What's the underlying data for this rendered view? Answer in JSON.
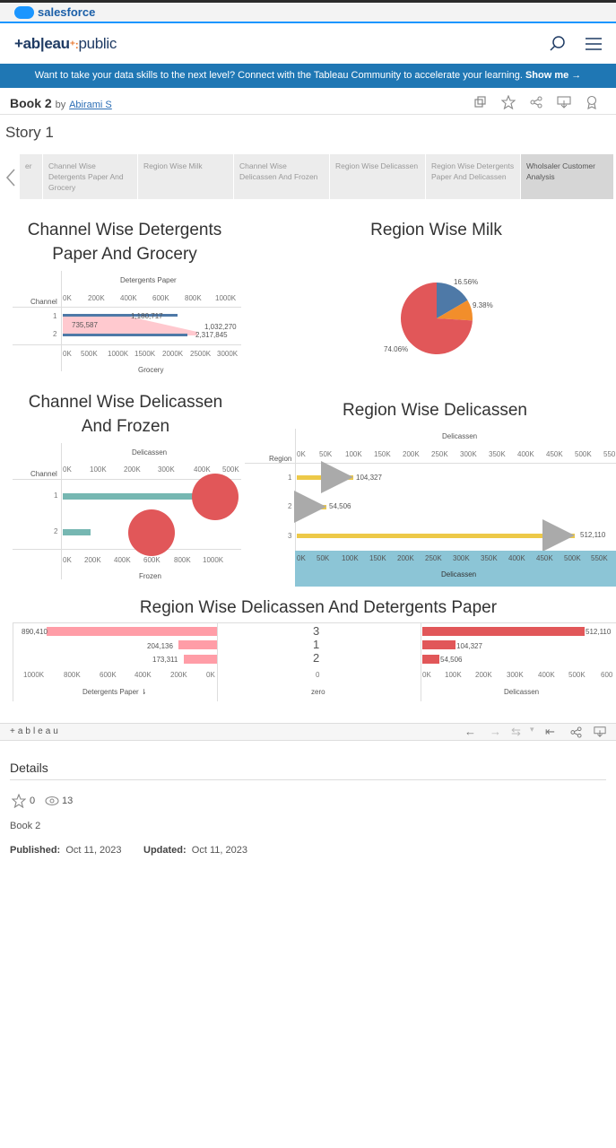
{
  "salesforce": {
    "logo_text": "salesforce"
  },
  "header": {
    "logo_main": "+ab|eau",
    "logo_sep": "⁺:",
    "logo_pub": "public"
  },
  "banner": {
    "text": "Want to take your data skills to the next level? Connect with the Tableau Community to accelerate your learning.",
    "link": "Show me →"
  },
  "book": {
    "title": "Book 2",
    "by": "by",
    "author": "Abirami S"
  },
  "story": {
    "title": "Story 1",
    "points": [
      {
        "label": "er"
      },
      {
        "label": "Channel Wise Detergents Paper And Grocery"
      },
      {
        "label": "Region Wise Milk"
      },
      {
        "label": "Channel Wise Delicassen And Frozen"
      },
      {
        "label": "Region Wise Delicassen"
      },
      {
        "label": "Region Wise Detergents Paper And Delicassen"
      },
      {
        "label": "Wholsaler Customer Analysis"
      }
    ]
  },
  "colors": {
    "accent": "#1f77b4",
    "red": "#e15759",
    "teal": "#76b7b2",
    "blue": "#4e79a7",
    "orange": "#f28e2b",
    "pink": "#ff9da7",
    "yellow": "#edc948",
    "grey": "#aaaaaa",
    "light_blue": "#8cc5d6"
  },
  "charts": {
    "c1": {
      "title_line1": "Channel Wise Detergents",
      "title_line2": "Paper And Grocery",
      "top_axis": "Detergents Paper",
      "bottom_axis": "Grocery",
      "row_header": "Channel",
      "top_ticks": [
        "0K",
        "200K",
        "400K",
        "600K",
        "800K",
        "1000K"
      ],
      "bottom_ticks": [
        "0K",
        "500K",
        "1000K",
        "1500K",
        "2000K",
        "2500K",
        "3000K"
      ],
      "rows": [
        "1",
        "2"
      ],
      "labels": [
        "1,180,717",
        "735,587",
        "1,032,270",
        "2,317,845"
      ]
    },
    "c2": {
      "title": "Region Wise Milk",
      "labels": [
        "16.56%",
        "9.38%",
        "74.06%"
      ]
    },
    "c3": {
      "title_line1": "Channel Wise Delicassen",
      "title_line2": "And Frozen",
      "top_axis": "Delicassen",
      "bottom_axis": "Frozen",
      "row_header": "Channel",
      "top_ticks": [
        "0K",
        "100K",
        "200K",
        "300K",
        "400K",
        "500K"
      ],
      "bottom_ticks": [
        "0K",
        "200K",
        "400K",
        "600K",
        "800K",
        "1000K"
      ],
      "rows": [
        "1",
        "2"
      ]
    },
    "c4": {
      "title": "Region Wise Delicassen",
      "top_axis": "Delicassen",
      "bottom_axis": "Delicassen",
      "row_header": "Region",
      "ticks": [
        "0K",
        "50K",
        "100K",
        "150K",
        "200K",
        "250K",
        "300K",
        "350K",
        "400K",
        "450K",
        "500K",
        "550"
      ],
      "bottom_ticks": [
        "0K",
        "50K",
        "100K",
        "150K",
        "200K",
        "250K",
        "300K",
        "350K",
        "400K",
        "450K",
        "500K",
        "550K"
      ],
      "rows": [
        "1",
        "2",
        "3"
      ],
      "labels": [
        "104,327",
        "54,506",
        "512,110"
      ]
    },
    "c5": {
      "title": "Region Wise Delicassen And Detergents Paper",
      "left_labels": [
        "890,410",
        "204,136",
        "173,311"
      ],
      "left_ticks": [
        "1000K",
        "800K",
        "600K",
        "400K",
        "200K",
        "0K"
      ],
      "left_axis": "Detergents Paper",
      "mid_rows": [
        "3",
        "1",
        "2"
      ],
      "mid_tick": "0",
      "mid_axis": "zero",
      "right_labels": [
        "512,110",
        "104,327",
        "54,506"
      ],
      "right_ticks": [
        "0K",
        "100K",
        "200K",
        "300K",
        "400K",
        "500K",
        "600"
      ],
      "right_axis": "Delicassen"
    }
  },
  "chart_data": [
    {
      "type": "bar",
      "title": "Channel Wise Detergents Paper And Grocery",
      "categories": [
        "1",
        "2"
      ],
      "series": [
        {
          "name": "Detergents Paper",
          "values": [
            1180717,
            735587
          ]
        },
        {
          "name": "Grocery",
          "values": [
            1032270,
            2317845
          ]
        }
      ]
    },
    {
      "type": "pie",
      "title": "Region Wise Milk",
      "categories": [
        "16.56%",
        "9.38%",
        "74.06%"
      ],
      "values": [
        16.56,
        9.38,
        74.06
      ]
    },
    {
      "type": "bar",
      "title": "Channel Wise Delicassen And Frozen",
      "categories": [
        "1",
        "2"
      ],
      "series": [
        {
          "name": "Delicassen",
          "values": [
            400000,
            80000
          ]
        },
        {
          "name": "Frozen",
          "values": [
            1000000,
            580000
          ]
        }
      ]
    },
    {
      "type": "bar",
      "title": "Region Wise Delicassen",
      "categories": [
        "1",
        "2",
        "3"
      ],
      "values": [
        104327,
        54506,
        512110
      ]
    },
    {
      "type": "bar",
      "title": "Region Wise Delicassen And Detergents Paper",
      "categories": [
        "3",
        "1",
        "2"
      ],
      "series": [
        {
          "name": "Detergents Paper",
          "values": [
            890410,
            204136,
            173311
          ]
        },
        {
          "name": "Delicassen",
          "values": [
            512110,
            104327,
            54506
          ]
        }
      ]
    }
  ],
  "toolbar": {
    "logo": "+ableau"
  },
  "details": {
    "heading": "Details",
    "favorites": "0",
    "views": "13",
    "book_name": "Book 2",
    "published_label": "Published:",
    "published": "Oct 11, 2023",
    "updated_label": "Updated:",
    "updated": "Oct 11, 2023"
  }
}
